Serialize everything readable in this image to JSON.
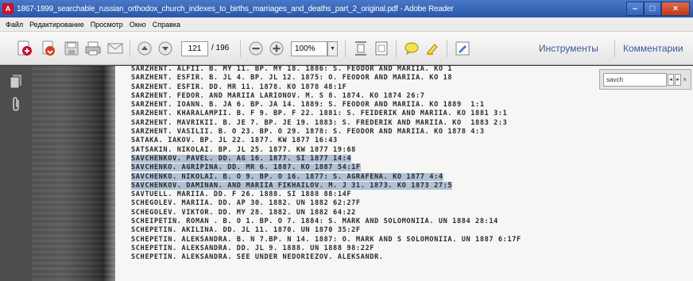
{
  "window": {
    "title": "1867-1899_searchable_russian_orthodox_church_indexes_to_births_marriages_and_deaths_part_2_original.pdf - Adobe Reader",
    "app_icon_glyph": "A",
    "minimize": "–",
    "maximize": "□",
    "close": "×"
  },
  "menu": [
    "Файл",
    "Редактирование",
    "Просмотр",
    "Окно",
    "Справка"
  ],
  "toolbar": {
    "page_current": "121",
    "page_total": "/ 196",
    "zoom": "100%",
    "zoom_dropdown": "▼",
    "tools_label": "Инструменты",
    "comments_label": "Комментарии"
  },
  "find": {
    "query": "savch",
    "prev": "◂",
    "next": "▸",
    "close": "×"
  },
  "document": {
    "lines": [
      {
        "text": "SARZHENT. ALFII. B. MY 11. BP. MY 18. 1886: S. FEODOR AND MARIIA. KO 1",
        "highlight": false
      },
      {
        "text": "SARZHENT. ESFIR. B. JL 4. BP. JL 12. 1875: O. FEODOR AND MARIIA. KO 18",
        "highlight": false
      },
      {
        "text": "SARZHENT. ESFIR. DD. MR 11. 1878. KO 1878 48:1F",
        "highlight": false
      },
      {
        "text": "SARZHENT. FEDOR. AND MARIIA LARIONOV. M. S 8. 1874. KO 1874 26:7",
        "highlight": false
      },
      {
        "text": "SARZHENT. IOANN. B. JA 6. BP. JA 14. 1889: S. FEODOR AND MARIIA. KO 1889  1:1",
        "highlight": false
      },
      {
        "text": "SARZHENT. KHARALAMPII. B. F 9. BP. F 22. 1881: S. FEIDERIK AND MARIIA. KO 1881 3:1",
        "highlight": false
      },
      {
        "text": "SARZHENT. MAVRIKII. B. JE 7. BP. JE 19. 1883: S. FREDERIK AND MARIIA. KO  1883 2:3",
        "highlight": false
      },
      {
        "text": "SARZHENT. VASILII. B. O 23. BP. O 29. 1878: S. FEODOR AND MARIIA. KO 1878 4:3",
        "highlight": false
      },
      {
        "text": "SATAKA. IAKOV. BP. JL 22. 1877. KW 1877 16:43",
        "highlight": false
      },
      {
        "text": "SATSAKIN. NIKOLAI. BP. JL 25. 1877. KW 1877 19:68",
        "highlight": false
      },
      {
        "text": "SAVCHENKOV. PAVEL. DD. AG 16. 1877. SI 1877 14:4",
        "highlight": true
      },
      {
        "text": "SAVCHENKO. AGRIPINA. DD. MR 6. 1887. KO 1887 54:1F",
        "highlight": true
      },
      {
        "text": "SAVCHENKO. NIKOLAI. B. O 9. BP. O 16. 1877: S. AGRAFENA. KO 1877 4:4",
        "highlight": true
      },
      {
        "text": "SAVCHENKOV. DAMINAN. AND MARIIA FIKHAILOV. M. J 31. 1873. KO 1873 27:5",
        "highlight": true
      },
      {
        "text": "SAVTUELL. MARIIA. DD. F 26. 1888. SI 1888 88:14F",
        "highlight": false
      },
      {
        "text": "SCHEGOLEV. MARIIA. DD. AP 30. 1882. UN 1882 62:27F",
        "highlight": false
      },
      {
        "text": "SCHEGOLEV. VIKTOR. DD. MY 28. 1882. UN 1882 64:22",
        "highlight": false
      },
      {
        "text": "SCHEIPETIN. ROMAN . B. O 1. BP. O 7. 1884: S. MARK AND SOLOMONIIA. UN 1884 28:14",
        "highlight": false
      },
      {
        "text": "SCHEPETIN. AKILINA. DD. JL 11. 1870. UN 1870 35:2F",
        "highlight": false
      },
      {
        "text": "SCHEPETIN. ALEKSANDRA. B. N 7.BP. N 14. 1887: O. MARK AND S SOLOMONIIA. UN 1887 6:17F",
        "highlight": false
      },
      {
        "text": "SCHEPETIN. ALEKSANDRA. DD. JL 9. 1888. UN 1888 98:22F",
        "highlight": false
      },
      {
        "text": "SCHEPETIN. ALEKSANDRA. SEE UNDER NEDORIEZOV. ALEKSANDR.",
        "highlight": false
      }
    ]
  },
  "colors": {
    "titlebar": "#2a56a8",
    "highlight": "#7896be",
    "toolbar": "#e4e4e4"
  }
}
